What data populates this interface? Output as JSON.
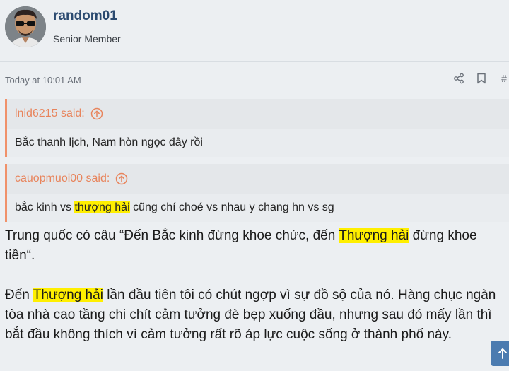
{
  "user": {
    "name": "random01",
    "title": "Senior Member",
    "avatar_icon": "avatar-sunglasses"
  },
  "post": {
    "date": "Today at 10:01 AM",
    "icons": [
      "share-icon",
      "bookmark-icon",
      "permalink-icon"
    ],
    "permalink_label": "#"
  },
  "quotes": [
    {
      "author_said": "lnid6215 said:",
      "body_pre": "Bắc thanh lịch, Nam hòn ngọc đây rồi",
      "body_hl": "",
      "body_post": ""
    },
    {
      "author_said": "cauopmuoi00 said:",
      "body_pre": "bắc kinh vs ",
      "body_hl": "thượng hải",
      "body_post": " cũng chí choé vs nhau y chang hn vs sg"
    }
  ],
  "article": {
    "p1_pre": "Trung quốc có câu “Đến Bắc kinh đừng khoe chức, đến ",
    "p1_hl": "Thượng hải",
    "p1_post": " đừng khoe tiền“.",
    "p2_pre": "Đến ",
    "p2_hl": "Thượng hải",
    "p2_post": " lần đầu tiên tôi có chút ngợp vì sự đồ sộ của nó. Hàng chục ngàn tòa nhà cao tầng chi chít cảm tưởng đè bẹp xuống đầu, nhưng sau đó mấy lần thì bắt đầu không thích vì cảm tưởng rất rõ áp lực cuộc sống ở thành phố này."
  },
  "colors": {
    "quote_accent": "#f0916a",
    "highlight": "#ffef00",
    "username": "#2b4a70",
    "scroll_button": "#4b7bb0"
  }
}
